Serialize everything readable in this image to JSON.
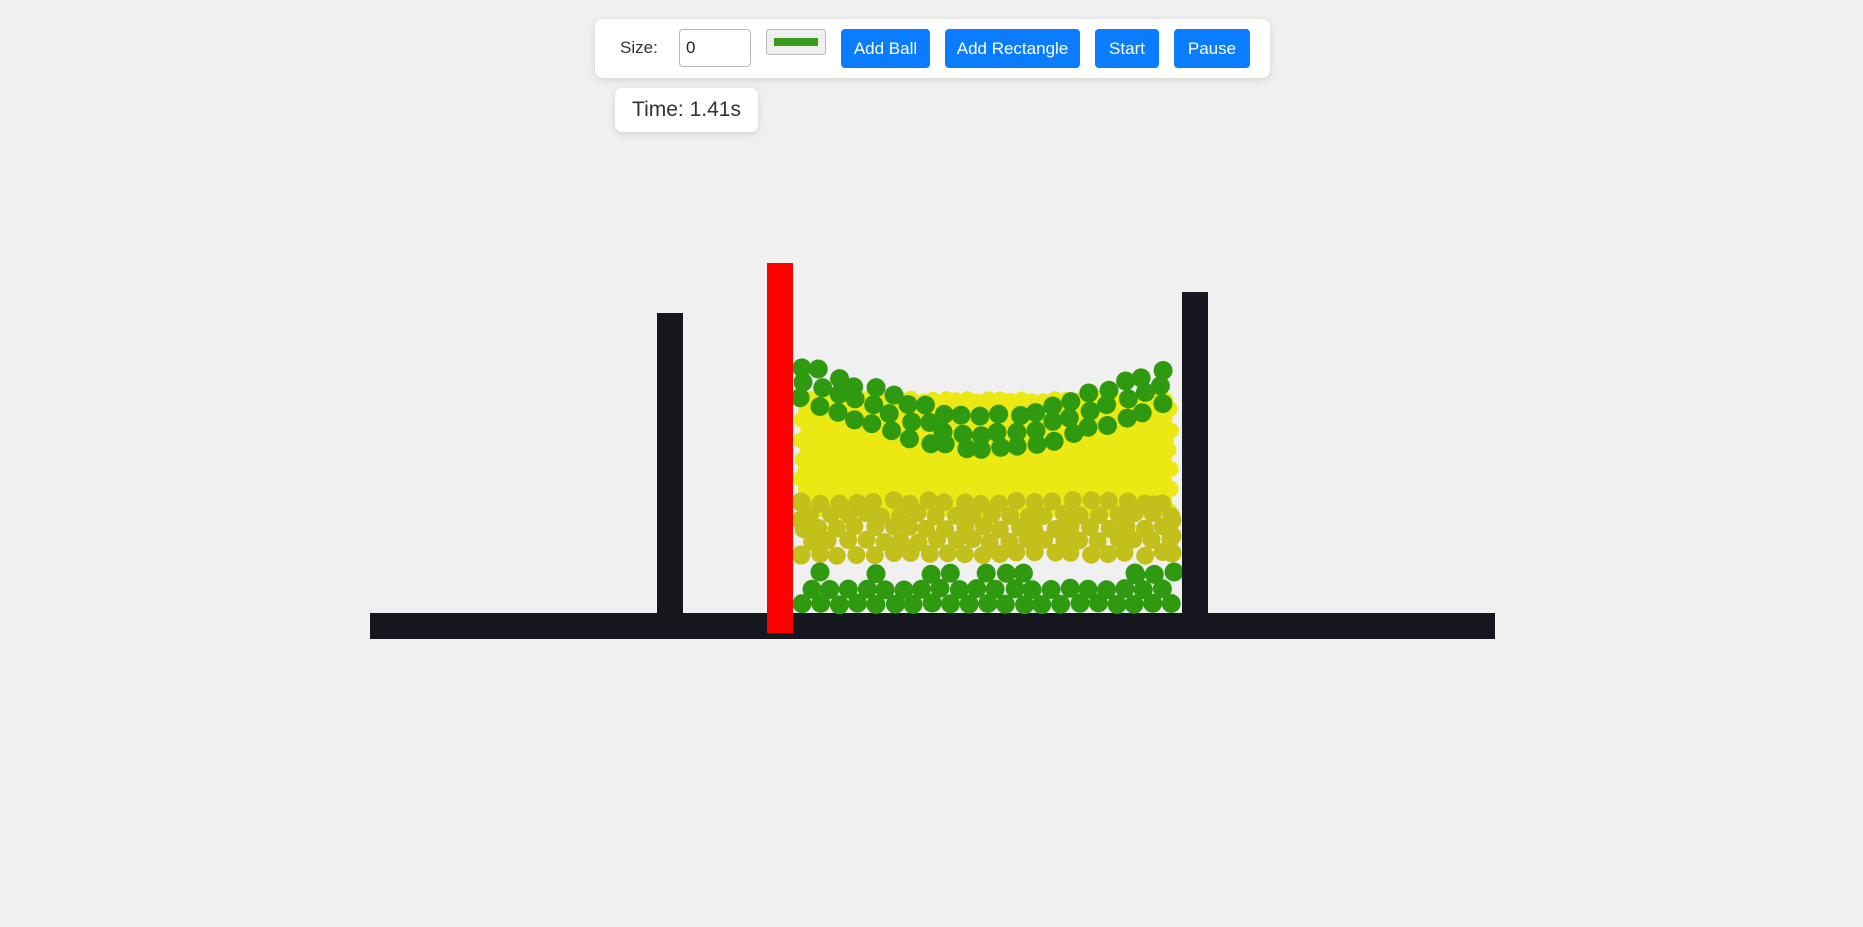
{
  "toolbar": {
    "size_label": "Size:",
    "size_value": "0",
    "color_value": "#3a9a1e",
    "add_ball_label": "Add Ball",
    "add_rectangle_label": "Add Rectangle",
    "start_label": "Start",
    "pause_label": "Pause",
    "button_color": "#0a7cff"
  },
  "timer": {
    "text": "Time: 1.41s"
  },
  "simulation": {
    "background": "#f0f0f0",
    "colors": {
      "ground": "#16161f",
      "wall": "#16161f",
      "red_wall": "#ff0000",
      "green_ball": "#2f9a0f",
      "yellow_ball": "#ece813",
      "olive_ball": "#c3c01c"
    },
    "objects": [
      {
        "name": "ground-platform",
        "kind": "static-rect",
        "color_key": "ground"
      },
      {
        "name": "left-wall",
        "kind": "static-rect",
        "color_key": "wall"
      },
      {
        "name": "red-wall",
        "kind": "dynamic-rect",
        "color_key": "red_wall"
      },
      {
        "name": "right-wall",
        "kind": "static-rect",
        "color_key": "wall"
      }
    ],
    "ball_layers": [
      {
        "name": "bottom-green-layer",
        "color_key": "green_ball"
      },
      {
        "name": "olive-layer",
        "color_key": "olive_ball"
      },
      {
        "name": "yellow-layer",
        "color_key": "yellow_ball"
      },
      {
        "name": "top-green-layer",
        "color_key": "green_ball"
      }
    ]
  }
}
